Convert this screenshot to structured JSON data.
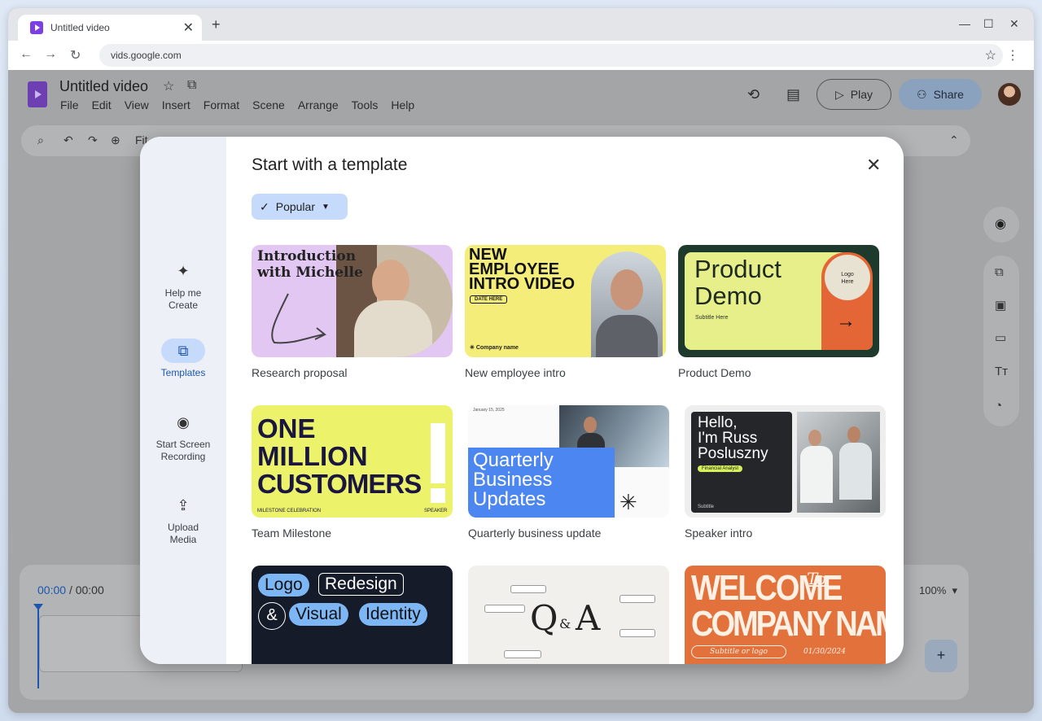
{
  "browser": {
    "tab_title": "Untitled video",
    "new_tab": "+",
    "close_tab": "✕",
    "url": "vids.google.com",
    "window_controls": [
      "—",
      "☐",
      "✕"
    ]
  },
  "app": {
    "doc_title": "Untitled video",
    "menus": [
      "File",
      "Edit",
      "View",
      "Insert",
      "Format",
      "Scene",
      "Arrange",
      "Tools",
      "Help"
    ],
    "play_label": "Play",
    "share_label": "Share",
    "toolbar_fit": "Fit",
    "timecode_current": "00:00",
    "timecode_total": "/ 00:00",
    "zoom_level": "100%"
  },
  "modal": {
    "title": "Start with a template",
    "filter_chip": "Popular",
    "sidebar": [
      {
        "line1": "Help me",
        "line2": "Create",
        "icon": "sparkle-icon"
      },
      {
        "line1": "Templates",
        "line2": "",
        "icon": "templates-icon"
      },
      {
        "line1": "Start Screen",
        "line2": "Recording",
        "icon": "record-icon"
      },
      {
        "line1": "Upload",
        "line2": "Media",
        "icon": "upload-icon"
      }
    ],
    "templates": [
      {
        "caption": "Research proposal",
        "t1": "Introduction",
        "t2": "with Michelle"
      },
      {
        "caption": "New employee intro",
        "t1": "NEW",
        "t2": "EMPLOYEE",
        "t3": "INTRO VIDEO",
        "t4": "DATE HERE",
        "t5": "Company name"
      },
      {
        "caption": "Product Demo",
        "t1": "Product",
        "t2": "Demo",
        "t3": "Subtitle Here",
        "t4": "Logo",
        "t5": "Here"
      },
      {
        "caption": "Team Milestone",
        "t1": "ONE",
        "t2": "MILLION",
        "t3": "CUSTOMERS",
        "t4": "MILESTONE CELEBRATION",
        "t5": "SPEAKER"
      },
      {
        "caption": "Quarterly business update",
        "t1": "Quarterly",
        "t2": "Business",
        "t3": "Updates",
        "t4": "January 15, 2025"
      },
      {
        "caption": "Speaker intro",
        "t1": "Hello,",
        "t2": "I'm Russ",
        "t3": "Posluszny",
        "t4": "Financial Analyst",
        "t5": "Subtitle"
      },
      {
        "caption": "",
        "t1": "Logo",
        "t2": "Redesign",
        "t3": "&",
        "t4": "Visual",
        "t5": "Identity"
      },
      {
        "caption": "",
        "t1": "Q",
        "t2": "&",
        "t3": "A"
      },
      {
        "caption": "",
        "t1": "WELCOME",
        "t2": "To",
        "t3": "COMPANY NAME",
        "t4": "Subtitle or logo",
        "t5": "01/30/2024"
      }
    ]
  },
  "colors": {
    "accent": "#1a56b0",
    "chip_bg": "#c6dafc",
    "brand": "#7b3fe4"
  }
}
